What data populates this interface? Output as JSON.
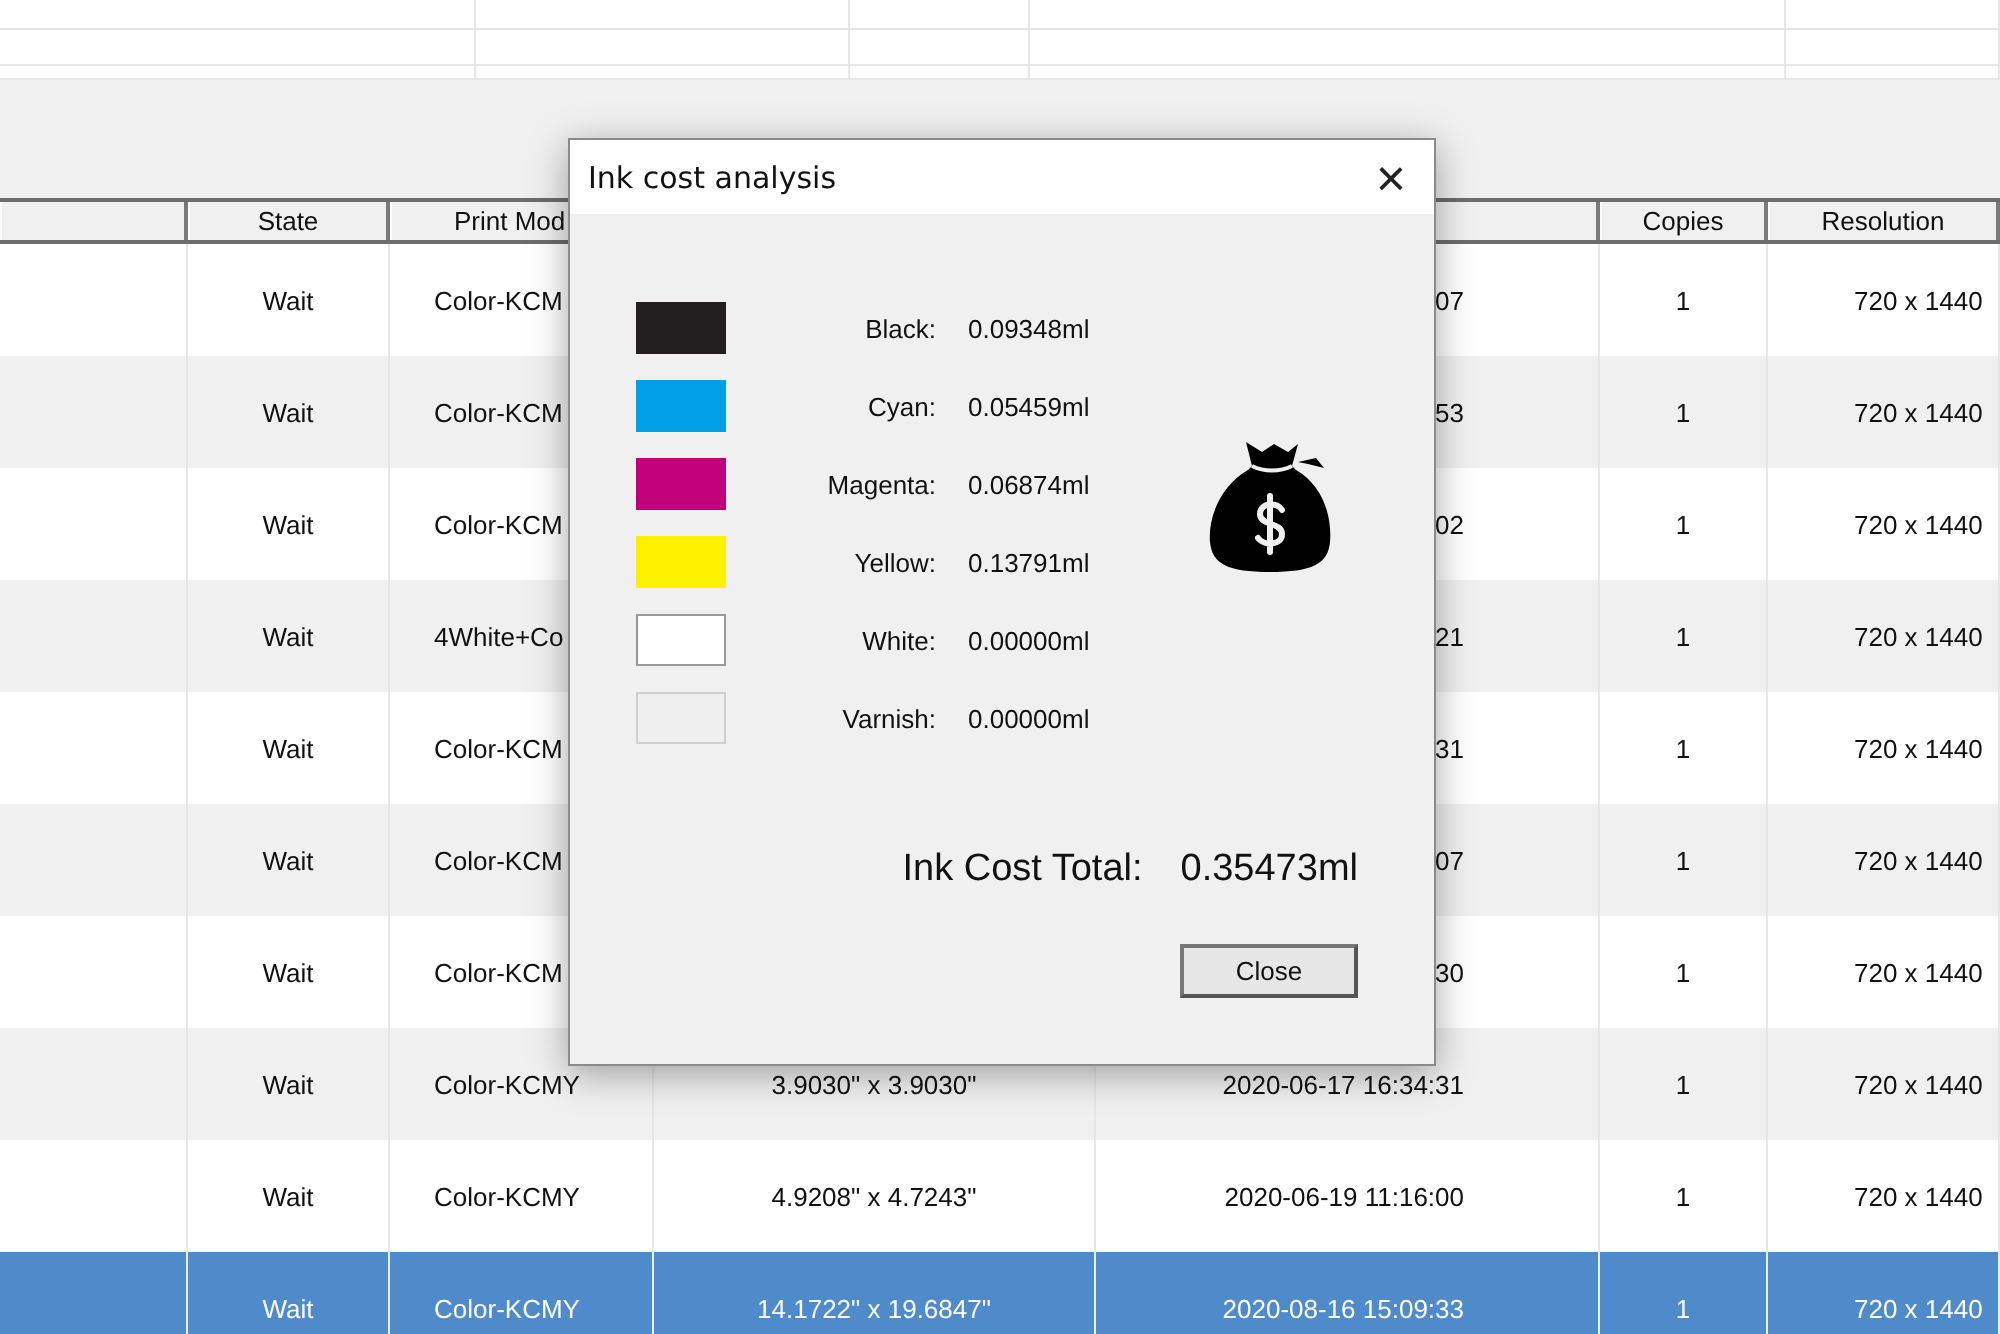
{
  "table": {
    "columns": [
      {},
      {
        "label": "State"
      },
      {
        "label": "Print Mod"
      },
      {},
      {},
      {
        "label": "Copies"
      },
      {
        "label": "Resolution"
      }
    ],
    "rows": [
      {
        "selected": false,
        "cells": [
          "",
          "Wait",
          "Color-KCM",
          "",
          "07",
          "1",
          "720 x 1440"
        ]
      },
      {
        "selected": false,
        "cells": [
          "",
          "Wait",
          "Color-KCM",
          "",
          "53",
          "1",
          "720 x 1440"
        ]
      },
      {
        "selected": false,
        "cells": [
          "",
          "Wait",
          "Color-KCM",
          "",
          "02",
          "1",
          "720 x 1440"
        ]
      },
      {
        "selected": false,
        "cells": [
          "",
          "Wait",
          "4White+Co",
          "",
          "21",
          "1",
          "720 x 1440"
        ]
      },
      {
        "selected": false,
        "cells": [
          "",
          "Wait",
          "Color-KCM",
          "",
          "31",
          "1",
          "720 x 1440"
        ]
      },
      {
        "selected": false,
        "cells": [
          "",
          "Wait",
          "Color-KCM",
          "",
          "07",
          "1",
          "720 x 1440"
        ]
      },
      {
        "selected": false,
        "cells": [
          "",
          "Wait",
          "Color-KCM",
          "",
          "30",
          "1",
          "720 x 1440"
        ]
      },
      {
        "selected": false,
        "cells": [
          "",
          "Wait",
          "Color-KCMY",
          "3.9030\" x 3.9030\"",
          "2020-06-17 16:34:31",
          "1",
          "720 x 1440"
        ]
      },
      {
        "selected": false,
        "cells": [
          "",
          "Wait",
          "Color-KCMY",
          "4.9208\" x 4.7243\"",
          "2020-06-19 11:16:00",
          "1",
          "720 x 1440"
        ]
      },
      {
        "selected": true,
        "cells": [
          "",
          "Wait",
          "Color-KCMY",
          "14.1722\" x 19.6847\"",
          "2020-08-16 15:09:33",
          "1",
          "720 x 1440"
        ]
      }
    ]
  },
  "dialog": {
    "title": "Ink cost analysis",
    "close_glyph": "×",
    "inks": [
      {
        "label": "Black:",
        "value": "0.09348ml",
        "color": "#231f20"
      },
      {
        "label": "Cyan:",
        "value": "0.05459ml",
        "color": "#00a0e9"
      },
      {
        "label": "Magenta:",
        "value": "0.06874ml",
        "color": "#c1007a"
      },
      {
        "label": "Yellow:",
        "value": "0.13791ml",
        "color": "#fff100"
      },
      {
        "label": "White:",
        "value": "0.00000ml",
        "color": "#ffffff"
      },
      {
        "label": "Varnish:",
        "value": "0.00000ml",
        "color": "#efefef"
      }
    ],
    "total_label": "Ink Cost Total:",
    "total_value": "0.35473ml",
    "button": "Close"
  }
}
